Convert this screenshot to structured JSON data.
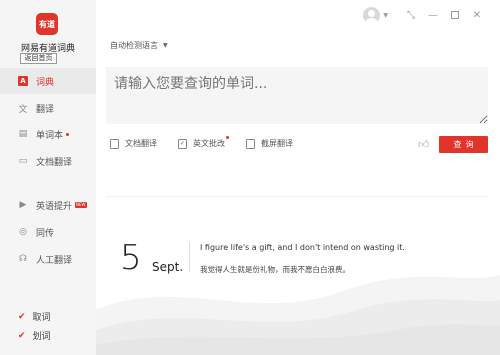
{
  "app": {
    "logo_text": "有道",
    "name": "网易有道词典",
    "back_home": "返回首页"
  },
  "sidebar": {
    "items": [
      {
        "label": "词典",
        "icon": "A"
      },
      {
        "label": "翻译",
        "icon": "文"
      },
      {
        "label": "单词本",
        "icon": "▤"
      },
      {
        "label": "文档翻译",
        "icon": "▭"
      },
      {
        "label": "英语提升",
        "icon": "▶",
        "badge": "NEW"
      },
      {
        "label": "同传",
        "icon": "◎"
      },
      {
        "label": "人工翻译",
        "icon": "☊"
      }
    ],
    "checks": [
      {
        "label": "取词",
        "checked": true
      },
      {
        "label": "划词",
        "checked": true
      }
    ]
  },
  "header": {
    "lang_select": "自动检测语言"
  },
  "search": {
    "placeholder": "请输入您要查询的单词..."
  },
  "tools": [
    {
      "label": "文档翻译"
    },
    {
      "label": "英文批改"
    },
    {
      "label": "截屏翻译"
    }
  ],
  "query_button": "查询",
  "daily_quote": {
    "day": "5",
    "month": "Sept.",
    "english": "I figure life's a gift, and I don't intend on wasting it.",
    "chinese": "我觉得人生就是份礼物，而我不愿白白浪费。"
  },
  "colors": {
    "accent": "#e0352b",
    "sidebar_bg": "#f5f5f5"
  }
}
